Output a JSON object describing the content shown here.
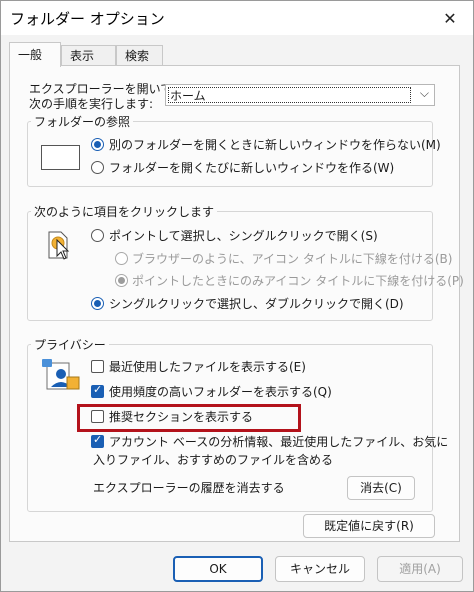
{
  "window": {
    "title": "フォルダー オプション",
    "close_glyph": "✕"
  },
  "tabs": [
    "一般",
    "表示",
    "検索"
  ],
  "open_explorer": {
    "label_line1": "エクスプローラーを開いて、",
    "label_line2": "次の手順を実行します:",
    "value": "ホーム",
    "caret": "⌵"
  },
  "browse_group": {
    "title": "フォルダーの参照",
    "options": [
      {
        "label": "別のフォルダーを開くときに新しいウィンドウを作らない(M)",
        "checked": true
      },
      {
        "label": "フォルダーを開くたびに新しいウィンドウを作る(W)",
        "checked": false
      }
    ]
  },
  "click_group": {
    "title": "次のように項目をクリックします",
    "options": [
      {
        "label": "ポイントして選択し、シングルクリックで開く(S)",
        "checked": false,
        "disabled": false
      },
      {
        "label": "ブラウザーのように、アイコン タイトルに下線を付ける(B)",
        "checked": false,
        "disabled": true
      },
      {
        "label": "ポイントしたときにのみアイコン タイトルに下線を付ける(P)",
        "checked": true,
        "disabled": true
      },
      {
        "label": "シングルクリックで選択し、ダブルクリックで開く(D)",
        "checked": true,
        "disabled": false
      }
    ]
  },
  "privacy_group": {
    "title": "プライバシー",
    "options": [
      {
        "label": "最近使用したファイルを表示する(E)",
        "checked": false
      },
      {
        "label": "使用頻度の高いフォルダーを表示する(Q)",
        "checked": true
      },
      {
        "label": "推奨セクションを表示する",
        "checked": false
      },
      {
        "label_line1": "アカウント ベースの分析情報、最近使用したファイル、お気に",
        "label_line2": "入りファイル、おすすめのファイルを含める",
        "checked": true
      }
    ],
    "clear_history_label": "エクスプローラーの履歴を消去する",
    "clear_button": "消去(C)"
  },
  "restore_defaults_button": "既定値に戻す(R)",
  "footer": {
    "ok": "OK",
    "cancel": "キャンセル",
    "apply": "適用(A)"
  },
  "colors": {
    "accent": "#1a5fb4",
    "highlight": "#b3121b"
  }
}
